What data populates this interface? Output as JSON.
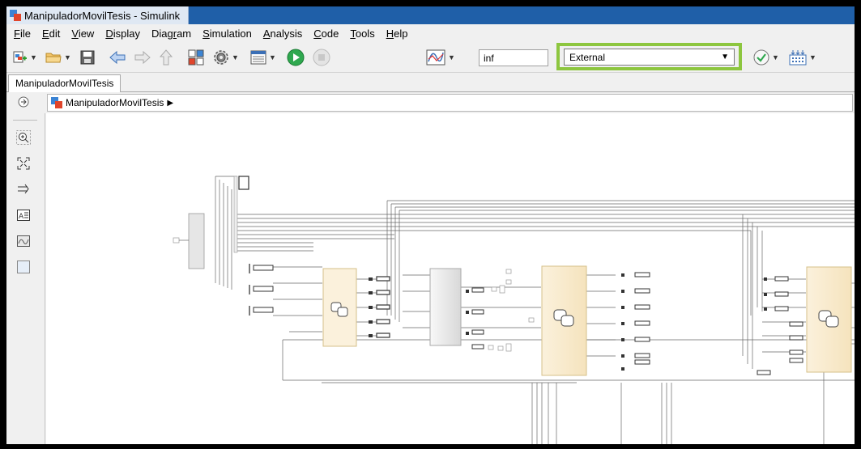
{
  "window": {
    "title": "ManipuladorMovilTesis - Simulink"
  },
  "menu": [
    {
      "label": "File",
      "u": "F",
      "rest": "ile"
    },
    {
      "label": "Edit",
      "u": "E",
      "rest": "dit"
    },
    {
      "label": "View",
      "u": "V",
      "rest": "iew"
    },
    {
      "label": "Display",
      "u": "D",
      "rest": "isplay"
    },
    {
      "label": "Diagram",
      "pre": "Diag",
      "u": "r",
      "rest": "am"
    },
    {
      "label": "Simulation",
      "u": "S",
      "rest": "imulation"
    },
    {
      "label": "Analysis",
      "u": "A",
      "rest": "nalysis"
    },
    {
      "label": "Code",
      "u": "C",
      "rest": "ode"
    },
    {
      "label": "Tools",
      "u": "T",
      "rest": "ools"
    },
    {
      "label": "Help",
      "u": "H",
      "rest": "elp"
    }
  ],
  "toolbar": {
    "stop_time": "inf",
    "simulation_mode": "External",
    "accent": "#8dc63f"
  },
  "tabs": {
    "model_tab": "ManipuladorMovilTesis"
  },
  "address": {
    "model_name": "ManipuladorMovilTesis",
    "arrow": "▶"
  },
  "icons": {
    "new_model": "new-model-icon",
    "open": "open-folder-icon",
    "save": "save-icon",
    "back": "back-arrow-icon",
    "forward": "forward-arrow-icon",
    "up": "up-arrow-icon",
    "library_browser": "library-browser-icon",
    "model_settings": "gear-icon",
    "model_explorer": "model-explorer-icon",
    "run": "run-icon",
    "stop": "stop-icon",
    "data_inspector": "data-inspector-icon",
    "check": "check-icon",
    "build": "build-icon"
  }
}
